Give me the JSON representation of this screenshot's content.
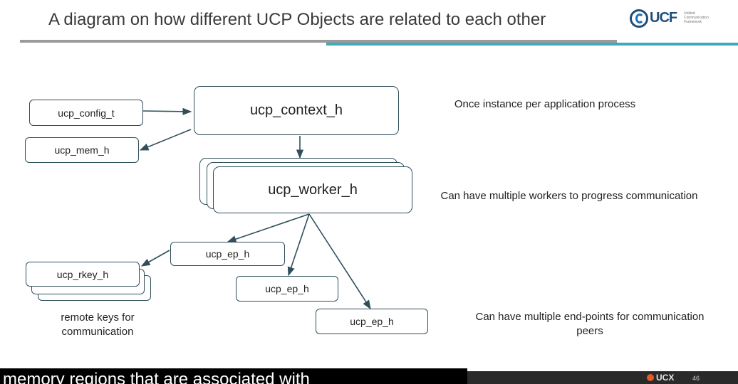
{
  "title": "A diagram on how different UCP Objects are related to each other",
  "logo": {
    "name": "UCF",
    "sub": "Unified Communication Framework"
  },
  "nodes": {
    "context": "ucp_context_h",
    "config": "ucp_config_t",
    "mem": "ucp_mem_h",
    "worker": "ucp_worker_h",
    "ep1": "ucp_ep_h",
    "ep2": "ucp_ep_h",
    "ep3": "ucp_ep_h",
    "rkey": "ucp_rkey_h"
  },
  "notes": {
    "context": "Once instance per application process",
    "worker": "Can have multiple workers to progress communication",
    "endpoints": "Can have multiple end-points for communication peers",
    "rkey": "remote keys for communication"
  },
  "footer": {
    "brand": "UCX",
    "page": "46"
  },
  "subtitle": "memory regions that are associated with"
}
